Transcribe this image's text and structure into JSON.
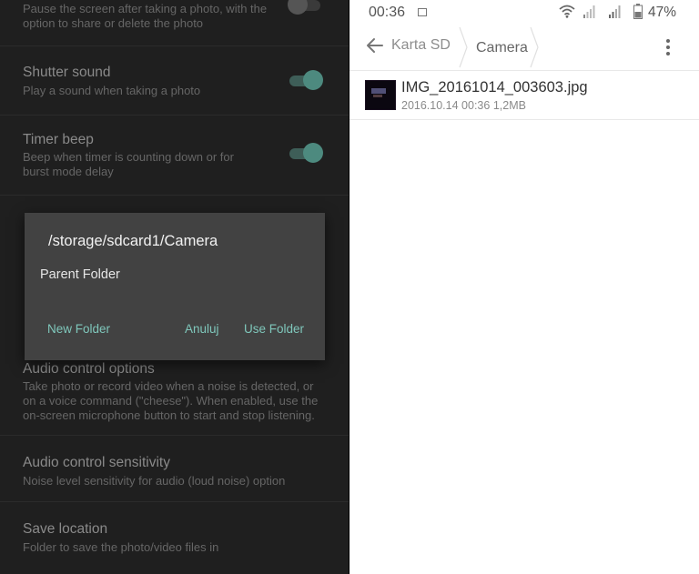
{
  "left_panel": {
    "settings": [
      {
        "title": "",
        "description": "Pause the screen after taking a photo, with the option to share or delete the photo",
        "toggle": "off"
      },
      {
        "title": "Shutter sound",
        "description": "Play a sound when taking a photo",
        "toggle": "on"
      },
      {
        "title": "Timer beep",
        "description": "Beep when timer is counting down or for burst mode delay",
        "toggle": "on"
      },
      {
        "title": "Audio control options",
        "description": "Take photo or record video when a noise is detected, or on a voice command (\"cheese\"). When enabled, use the on-screen microphone button to start and stop listening."
      },
      {
        "title": "Audio control sensitivity",
        "description": "Noise level sensitivity for audio (loud noise) option"
      },
      {
        "title": "Save location",
        "description": "Folder to save the photo/video files in"
      }
    ],
    "dialog": {
      "path": "/storage/sdcard1/Camera",
      "item": "Parent Folder",
      "new_folder_label": "New Folder",
      "cancel_label": "Anuluj",
      "use_folder_label": "Use Folder",
      "accent_color": "#7fc7bb"
    }
  },
  "right_panel": {
    "status_bar": {
      "time": "00:36",
      "battery_percent": "47%"
    },
    "breadcrumbs": [
      "Karta SD",
      "Camera"
    ],
    "files": [
      {
        "name": "IMG_20161014_003603.jpg",
        "date": "2016.10.14 00:36",
        "size": "1,2MB"
      }
    ]
  }
}
